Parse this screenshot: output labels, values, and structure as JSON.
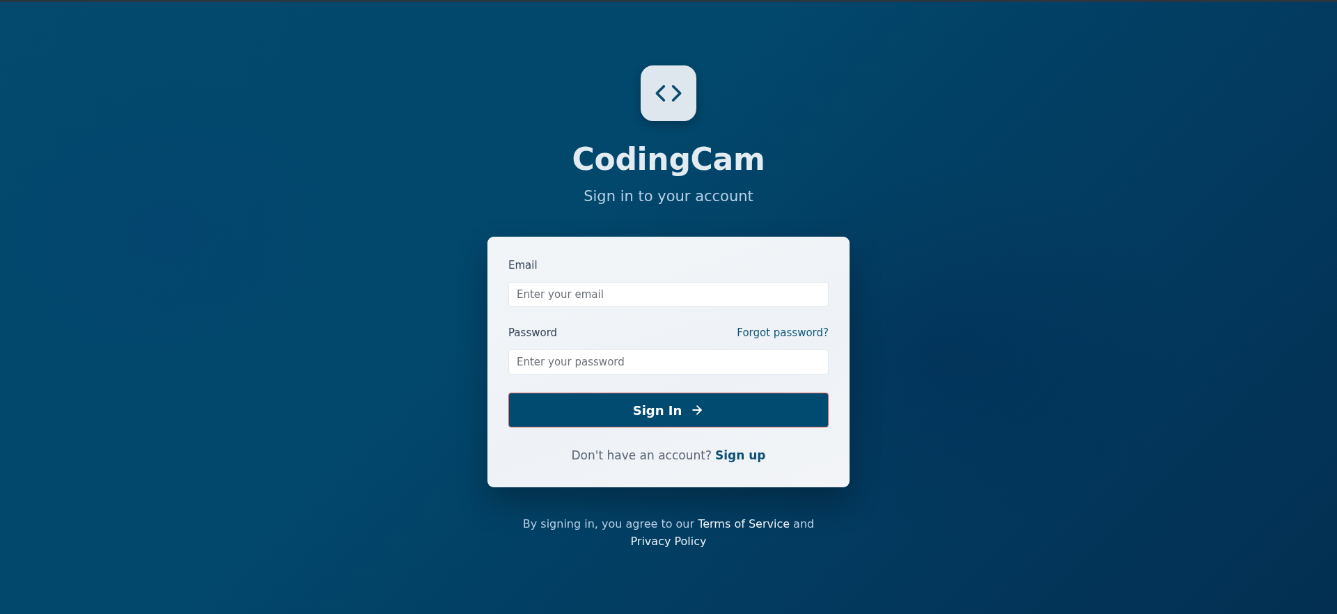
{
  "brand": {
    "title": "CodingCam",
    "subtitle": "Sign in to your account"
  },
  "form": {
    "fields": [
      {
        "label": "Email",
        "placeholder": "Enter your email"
      },
      {
        "label": "Password",
        "placeholder": "Enter your password",
        "link": "Forgot password?"
      }
    ],
    "submit": "Sign In",
    "signup": {
      "prompt": "Don't have an account?",
      "link": "Sign up"
    }
  },
  "footer": {
    "parts": [
      {
        "kind": "text",
        "text": "By signing in, you agree to our"
      },
      {
        "kind": "link",
        "text": "Terms of Service"
      },
      {
        "kind": "text",
        "text": "and"
      },
      {
        "kind": "link",
        "text": "Privacy Policy"
      }
    ]
  }
}
